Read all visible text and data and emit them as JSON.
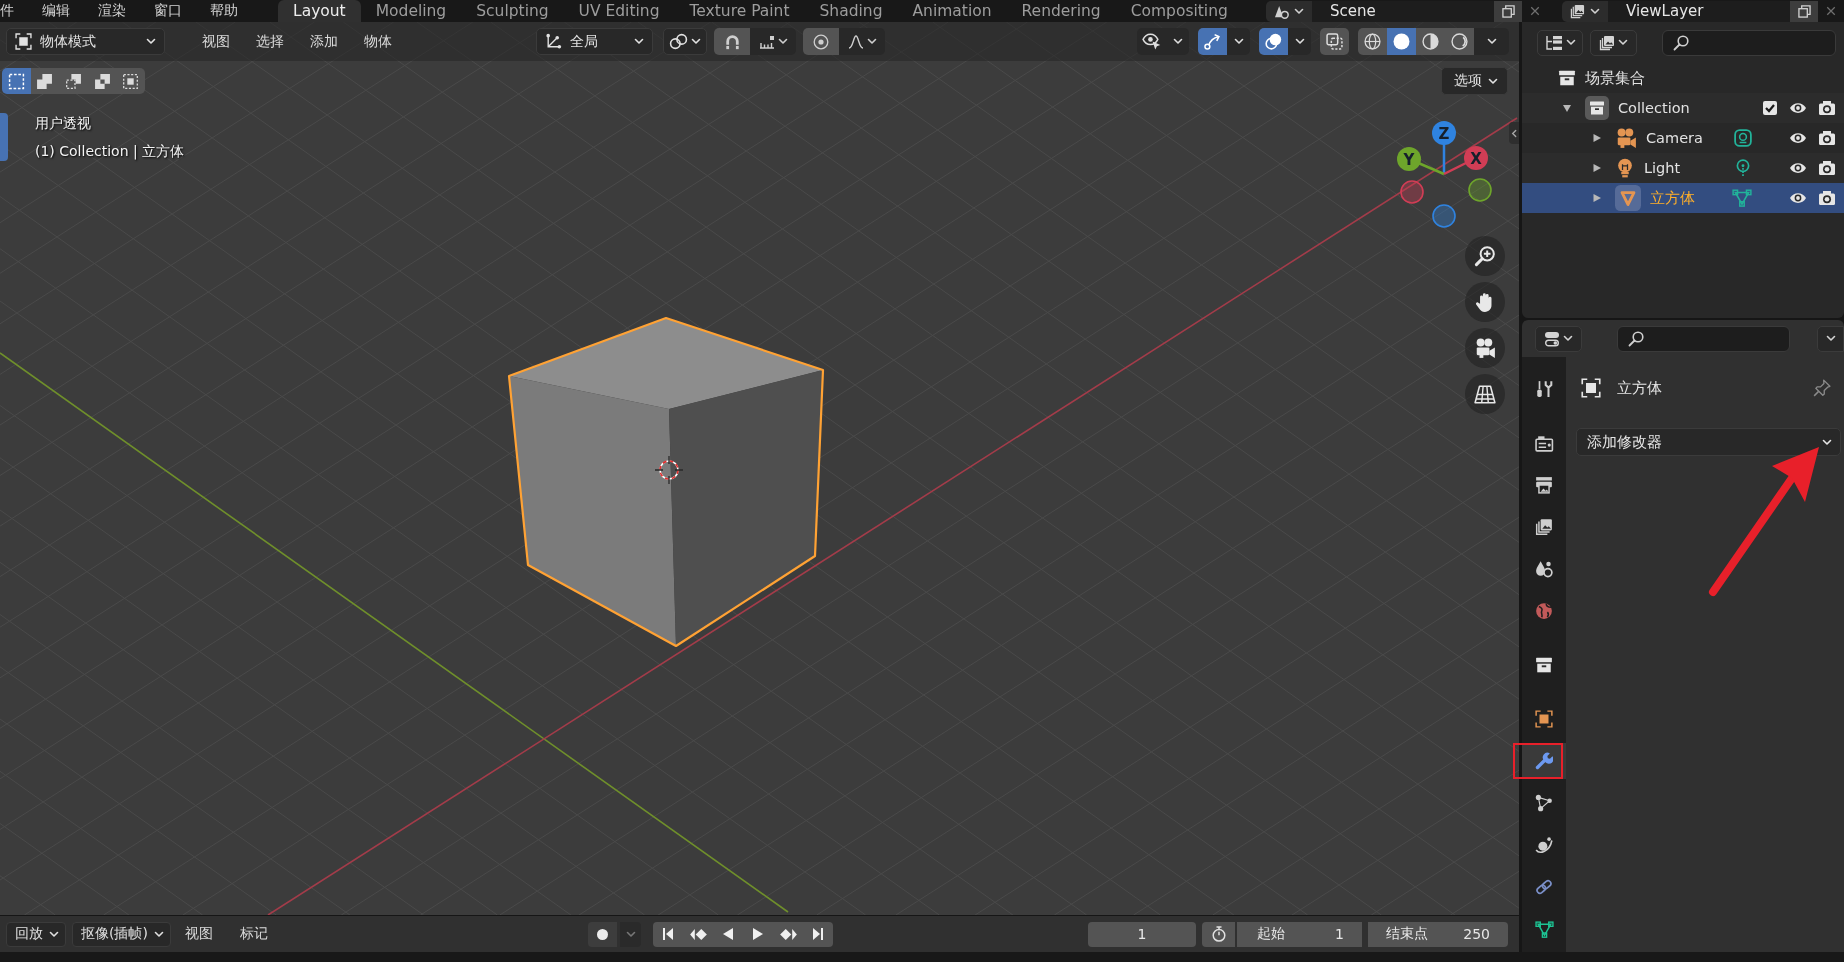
{
  "top_bar": {
    "menus": [
      "件",
      "编辑",
      "渲染",
      "窗口",
      "帮助"
    ],
    "workspaces": [
      {
        "label": "Layout",
        "selected": true
      },
      {
        "label": "Modeling",
        "selected": false
      },
      {
        "label": "Sculpting",
        "selected": false
      },
      {
        "label": "UV Editing",
        "selected": false
      },
      {
        "label": "Texture Paint",
        "selected": false
      },
      {
        "label": "Shading",
        "selected": false
      },
      {
        "label": "Animation",
        "selected": false
      },
      {
        "label": "Rendering",
        "selected": false
      },
      {
        "label": "Compositing",
        "selected": false
      }
    ],
    "scene": "Scene",
    "view_layer": "ViewLayer"
  },
  "viewport": {
    "mode": "物体模式",
    "menus": [
      "视图",
      "选择",
      "添加",
      "物体"
    ],
    "orientation": "全局",
    "toggles": [
      {
        "kind": "visibility",
        "on": false
      },
      {
        "kind": "gizmo",
        "on": true
      },
      {
        "kind": "overlay",
        "on": true
      },
      {
        "kind": "xray",
        "on": false
      }
    ],
    "shading": [
      {
        "kind": "wireframe",
        "selected": false
      },
      {
        "kind": "solid",
        "selected": true
      },
      {
        "kind": "material",
        "selected": false
      },
      {
        "kind": "rendered",
        "selected": false
      }
    ],
    "select_modes": [
      {
        "kind": "set",
        "selected": true
      },
      {
        "kind": "extend",
        "selected": false
      },
      {
        "kind": "subtract",
        "selected": false
      },
      {
        "kind": "difference",
        "selected": false
      },
      {
        "kind": "intersect",
        "selected": false
      }
    ],
    "options": "选项",
    "view_name": "用户透视",
    "object_info": "(1) Collection | 立方体",
    "gizmo_axes": [
      {
        "kind": "z",
        "label": "Z",
        "color": "#2f83e0"
      },
      {
        "kind": "y",
        "label": "Y",
        "color": "#6ea52b"
      },
      {
        "kind": "x",
        "label": "X",
        "color": "#d13d55"
      }
    ]
  },
  "outliner": {
    "tree": [
      {
        "label": "场景集合",
        "kind": "scene_collection",
        "selected": false,
        "children": [
          {
            "label": "Collection",
            "kind": "collection",
            "expanded": true,
            "checked": true,
            "selected": false,
            "children": [
              {
                "label": "Camera",
                "kind": "camera",
                "expanded": false,
                "selected": false
              },
              {
                "label": "Light",
                "kind": "light",
                "expanded": false,
                "selected": false
              },
              {
                "label": "立方体",
                "kind": "mesh",
                "expanded": false,
                "selected": true
              }
            ]
          }
        ]
      }
    ]
  },
  "properties": {
    "tab_groups": [
      [
        {
          "kind": "tool",
          "selected": false,
          "marked": false
        }
      ],
      [
        {
          "kind": "render",
          "selected": false,
          "marked": false
        },
        {
          "kind": "output",
          "selected": false,
          "marked": false
        },
        {
          "kind": "view_layer",
          "selected": false,
          "marked": false
        },
        {
          "kind": "scene",
          "selected": false,
          "marked": false
        },
        {
          "kind": "world",
          "selected": false,
          "marked": false
        }
      ],
      [
        {
          "kind": "collection",
          "selected": false,
          "marked": false
        }
      ],
      [
        {
          "kind": "object",
          "selected": false,
          "marked": false
        },
        {
          "kind": "modifier",
          "selected": true,
          "marked": true
        },
        {
          "kind": "particles",
          "selected": false,
          "marked": false
        },
        {
          "kind": "physics",
          "selected": false,
          "marked": false
        },
        {
          "kind": "constraints",
          "selected": false,
          "marked": false
        },
        {
          "kind": "data",
          "selected": false,
          "marked": false
        }
      ]
    ],
    "object_name": "立方体",
    "add_modifier": "添加修改器",
    "arrow_annotation": true
  },
  "timeline": {
    "menus": [
      {
        "kind": "dropdown",
        "label": "回放"
      },
      {
        "kind": "dropdown",
        "label": "抠像(插帧)"
      },
      {
        "kind": "menu",
        "label": "视图"
      },
      {
        "kind": "menu",
        "label": "标记"
      }
    ],
    "current_frame": "1",
    "start": {
      "label": "起始",
      "value": "1"
    },
    "end": {
      "label": "结束点",
      "value": "250"
    }
  }
}
